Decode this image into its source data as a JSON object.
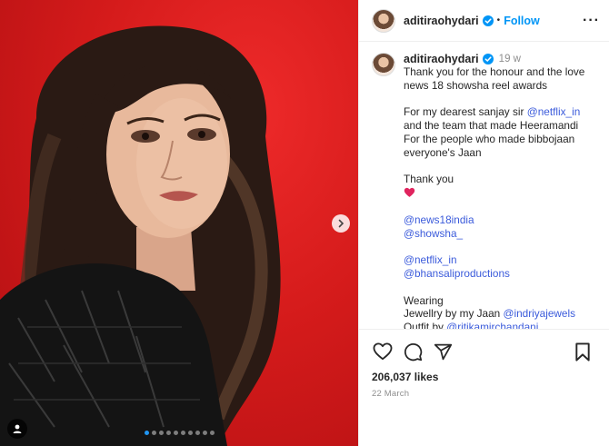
{
  "post": {
    "username": "aditiraohydari",
    "follow_label": "Follow",
    "separator": "•",
    "more_label": "···",
    "time_ago": "19 w",
    "caption_lines": [
      {
        "text": "Thank you for the honour and the love"
      },
      {
        "text": "news 18 showsha reel awards"
      },
      {
        "text": ""
      },
      {
        "text": "For my dearest sanjay sir ",
        "mention": "@netflix_in"
      },
      {
        "text": "and the team that made Heeramandi"
      },
      {
        "text": "For the people who made bibbojaan"
      },
      {
        "text": "everyone's Jaan"
      },
      {
        "text": ""
      },
      {
        "text": "Thank you"
      },
      {
        "emoji": "red-heart"
      },
      {
        "text": ""
      },
      {
        "mention": "@news18india"
      },
      {
        "mention": "@showsha_"
      },
      {
        "text": ""
      },
      {
        "mention": "@netflix_in"
      },
      {
        "mention": "@bhansaliproductions"
      },
      {
        "text": ""
      },
      {
        "text": "Wearing"
      },
      {
        "text": "Jewellry by my Jaan ",
        "mention": "@indriyajewels"
      },
      {
        "text": "Outfit by ",
        "mention": "@ritikamirchandani"
      }
    ],
    "likes": "206,037 likes",
    "date": "22 March"
  },
  "media": {
    "slide_count": 10,
    "active_slide": 1
  },
  "icons": {
    "verified": "verified-badge-icon",
    "like": "heart-icon",
    "comment": "comment-icon",
    "share": "share-icon",
    "save": "bookmark-icon",
    "next": "chevron-right-icon",
    "tag": "user-tag-icon"
  },
  "colors": {
    "accent": "#0095f6",
    "mention": "#3b5bdb",
    "background_red": "#d51b1b",
    "heart": "#e0245e"
  }
}
